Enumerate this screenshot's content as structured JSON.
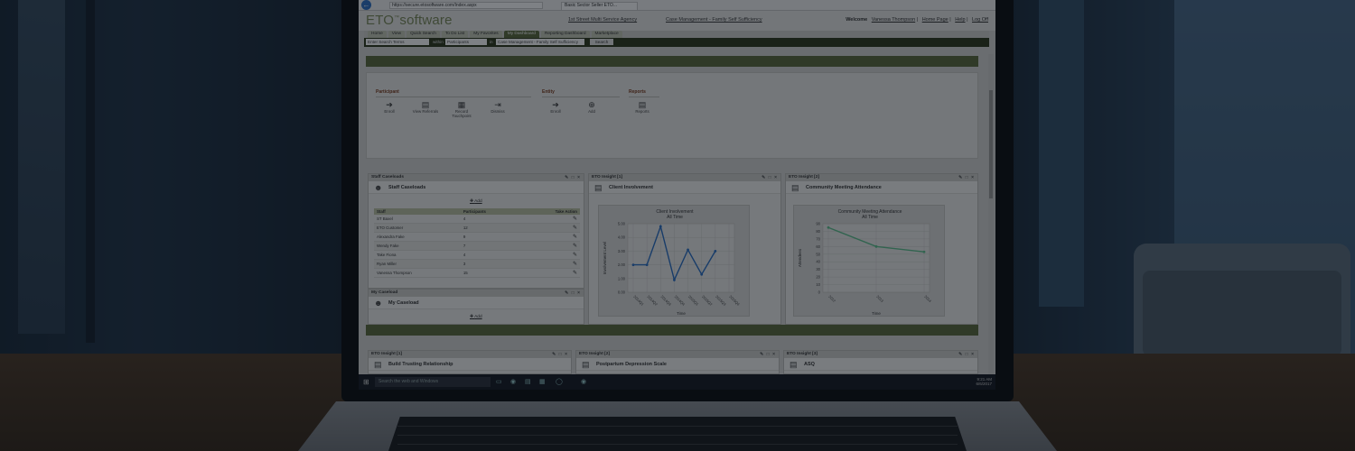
{
  "browser": {
    "url": "https://secure.etosoftware.com/Index.aspx",
    "tab_title": "Basic Sector Seller ETO..."
  },
  "header": {
    "logo_main": "ETO",
    "logo_tm": "™",
    "logo_sub": "software",
    "agency_link": "1st Street Multi Service Agency",
    "program_link": "Case Management - Family Self Sufficiency",
    "welcome_label": "Welcome",
    "user_name": "Vanessa Thompson",
    "home_link": "Home Page",
    "help_link": "Help",
    "logout_link": "Log Off"
  },
  "nav": {
    "tabs": [
      {
        "label": "Home",
        "active": false
      },
      {
        "label": "View",
        "active": false
      },
      {
        "label": "Quick Search",
        "active": false
      },
      {
        "label": "To Do List",
        "active": false
      },
      {
        "label": "My Favorites",
        "active": false
      },
      {
        "label": "My Dashboard",
        "active": true
      },
      {
        "label": "Reporting Dashboard",
        "active": false
      },
      {
        "label": "Marketplace",
        "active": false
      }
    ]
  },
  "search": {
    "placeholder": "Enter Search Terms",
    "within_label": "within",
    "entity_select": "Participants",
    "in_label": "in",
    "program_select": "Case Management - Family Self Sufficiency",
    "button": "Search"
  },
  "launchpad": {
    "groups": [
      {
        "title": "Participant",
        "items": [
          "Enroll",
          "View Referrals",
          "Record Touchpoint",
          "Dismiss"
        ]
      },
      {
        "title": "Entity",
        "items": [
          "Enroll",
          "Add"
        ]
      },
      {
        "title": "Reports",
        "items": [
          "Reports"
        ]
      }
    ]
  },
  "staff_caseloads": {
    "header": "Staff Caseloads",
    "title": "Staff Caseloads",
    "add": "Add",
    "columns": [
      "Staff",
      "Participants",
      "Take Action"
    ],
    "rows": [
      {
        "staff": "ST Baxel",
        "count": "4"
      },
      {
        "staff": "ETO Customer",
        "count": "12"
      },
      {
        "staff": "Alexandra Fake",
        "count": "9"
      },
      {
        "staff": "Wendy Fake",
        "count": "7"
      },
      {
        "staff": "Take Fiona",
        "count": "4"
      },
      {
        "staff": "Ryan Miller",
        "count": "3"
      },
      {
        "staff": "Vanessa Thompson",
        "count": "15"
      }
    ]
  },
  "my_caseload": {
    "header": "My Caseload",
    "title": "My Caseload",
    "add": "Add"
  },
  "insight_client": {
    "header": "ETO Insight [1]",
    "title": "Client Involvement"
  },
  "insight_community": {
    "header": "ETO Insight [2]",
    "title": "Community Meeting Attendance"
  },
  "bottom_widgets": [
    {
      "header": "ETO Insight [1]",
      "title": "Build Trusting Relationship"
    },
    {
      "header": "ETO Insight [2]",
      "title": "Postpartum Depression Scale"
    },
    {
      "header": "ETO Insight [3]",
      "title": "ASQ"
    }
  ],
  "taskbar": {
    "search_placeholder": "Search the web and Windows",
    "time": "9:21 AM",
    "date": "6/6/2017"
  },
  "chart_data": [
    {
      "type": "line",
      "title": "Client Involvement",
      "subtitle": "All Time",
      "xlabel": "Time",
      "ylabel": "Involvement Level",
      "categories": [
        "2014Q1",
        "2014Q2",
        "2014Q3",
        "2014Q4",
        "2015Q1",
        "2015Q2",
        "2015Q3",
        "2015Q4"
      ],
      "values": [
        2.0,
        2.0,
        4.8,
        0.9,
        3.1,
        1.3,
        3.0
      ],
      "ylim": [
        0.0,
        5.0
      ],
      "yticks": [
        "0.00",
        "1.00",
        "2.00",
        "3.00",
        "4.00",
        "5.00"
      ],
      "color": "#2a6fc4",
      "grid": true
    },
    {
      "type": "line",
      "title": "Community Meeting Attendance",
      "subtitle": "All Time",
      "xlabel": "Time",
      "ylabel": "Attendees",
      "categories": [
        "2012",
        "2013",
        "2014"
      ],
      "values": [
        85,
        60,
        53
      ],
      "ylim": [
        0,
        90
      ],
      "yticks": [
        "0",
        "10",
        "20",
        "30",
        "40",
        "50",
        "60",
        "70",
        "80",
        "90"
      ],
      "color": "#5fc28e",
      "grid": true
    }
  ]
}
